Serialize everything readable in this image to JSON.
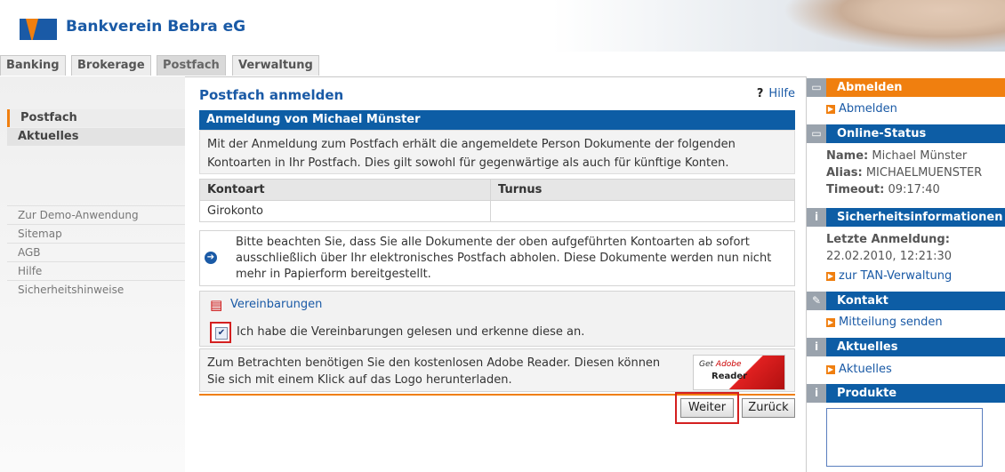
{
  "header": {
    "bank_name": "Bankverein Bebra eG"
  },
  "tabs": [
    "Banking",
    "Brokerage",
    "Postfach",
    "Verwaltung"
  ],
  "leftnav": {
    "sections": [
      "Postfach",
      "Aktuelles"
    ],
    "links": [
      "Zur Demo-Anwendung",
      "Sitemap",
      "AGB",
      "Hilfe",
      "Sicherheitshinweise"
    ]
  },
  "main": {
    "title": "Postfach anmelden",
    "help": "Hilfe",
    "bar": "Anmeldung von Michael Münster",
    "intro": "Mit der Anmeldung zum Postfach erhält die angemeldete Person Dokumente der folgenden Kontoarten in Ihr Postfach. Dies gilt sowohl für gegenwärtige als auch für künftige Konten.",
    "table": {
      "headers": [
        "Kontoart",
        "Turnus"
      ],
      "rows": [
        [
          "Girokonto",
          ""
        ]
      ]
    },
    "notice": "Bitte beachten Sie, dass Sie alle Dokumente der oben aufgeführten Kontoarten ab sofort ausschließlich über Ihr elektronisches Postfach abholen. Diese Dokumente werden nun nicht mehr in Papierform bereitgestellt.",
    "vereinbarungen": "Vereinbarungen",
    "agree_text": "Ich habe die Vereinbarungen gelesen und erkenne diese an.",
    "agree_checked": true,
    "reader_text": "Zum Betrachten benötigen Sie den kostenlosen Adobe Reader. Diesen können Sie sich mit einem Klick auf das Logo herunterladen.",
    "reader_logo": {
      "line1a": "Get ",
      "line1b": "Adobe",
      "line2": "Reader"
    },
    "buttons": {
      "next": "Weiter",
      "back": "Zurück"
    }
  },
  "right": {
    "abmelden": {
      "title": "Abmelden",
      "link": "Abmelden"
    },
    "status": {
      "title": "Online-Status",
      "name_label": "Name:",
      "name": "Michael Münster",
      "alias_label": "Alias:",
      "alias": "MICHAELMUENSTER",
      "timeout_label": "Timeout:",
      "timeout": "09:17:40"
    },
    "security": {
      "title": "Sicherheitsinformationen",
      "last_label": "Letzte Anmeldung:",
      "last_value": "22.02.2010, 12:21:30",
      "tan_link": "zur TAN-Verwaltung"
    },
    "kontakt": {
      "title": "Kontakt",
      "link": "Mitteilung senden"
    },
    "aktuelles": {
      "title": "Aktuelles",
      "link": "Aktuelles"
    },
    "produkte": {
      "title": "Produkte"
    }
  },
  "colors": {
    "brand_blue": "#0d5da5",
    "accent_orange": "#f07f0f",
    "highlight_red": "#d42020"
  }
}
